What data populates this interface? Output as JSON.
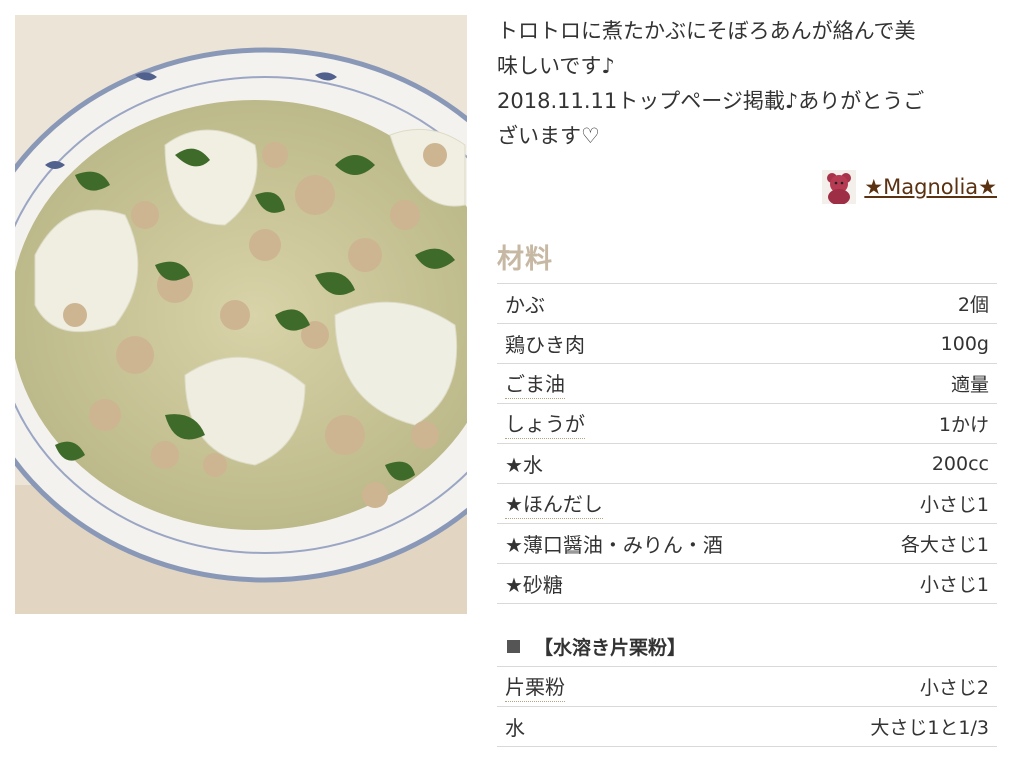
{
  "photo": {
    "icon": "recipe-photo"
  },
  "description": {
    "lines": [
      "トロトロに煮たかぶにそぼろあんが絡んで美",
      "味しいです♪",
      "2018.11.11トップページ掲載♪ありがとうご",
      "ざいます♡"
    ]
  },
  "author": {
    "name": "★Magnolia★",
    "avatar_icon": "teddy-bear-avatar"
  },
  "ingredients": {
    "heading": "材料",
    "items": [
      {
        "name": "かぶ",
        "qty": "2個",
        "link": false
      },
      {
        "name": "鶏ひき肉",
        "qty": "100g",
        "link": false
      },
      {
        "name": "ごま油",
        "qty": "適量",
        "link": true
      },
      {
        "name": "しょうが",
        "qty": "1かけ",
        "link": true
      },
      {
        "name": "★水",
        "qty": "200cc",
        "link": false
      },
      {
        "name": "★ほんだし",
        "qty": "小さじ1",
        "link": true
      },
      {
        "name": "★薄口醤油・みりん・酒",
        "qty": "各大さじ1",
        "link": false
      },
      {
        "name": "★砂糖",
        "qty": "小さじ1",
        "link": false
      }
    ]
  },
  "sub_section": {
    "heading": "【水溶き片栗粉】",
    "items": [
      {
        "name": "片栗粉",
        "qty": "小さじ2",
        "link": true
      },
      {
        "name": "水",
        "qty": "大さじ1と1/3",
        "link": false
      }
    ]
  },
  "colors": {
    "author_link": "#5a3212",
    "heading": "#c6b8a3",
    "divider": "#d9d9d9"
  }
}
